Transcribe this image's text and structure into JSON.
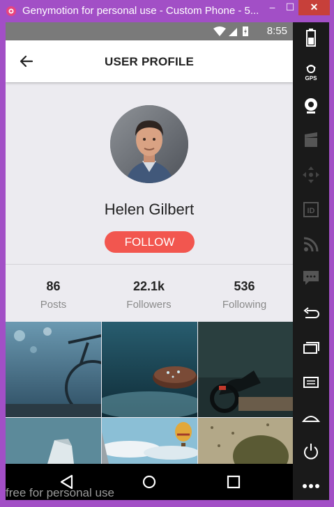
{
  "window": {
    "title": "Genymotion for personal use - Custom Phone - 5....",
    "minimize_glyph": "–",
    "maximize_glyph": "☐",
    "close_glyph": "✕"
  },
  "statusbar": {
    "time": "8:55"
  },
  "appbar": {
    "title": "USER PROFILE",
    "back_icon": "arrow-left-icon"
  },
  "profile": {
    "name": "Helen Gilbert",
    "follow_label": "FOLLOW",
    "accent": "#f2564f"
  },
  "stats": [
    {
      "value": "86",
      "label": "Posts"
    },
    {
      "value": "22.1k",
      "label": "Followers"
    },
    {
      "value": "536",
      "label": "Following"
    }
  ],
  "gallery": [
    "bicycle-photo",
    "coffee-beans-photo",
    "motorcycle-photo",
    "box-photo",
    "hot-air-balloon-photo",
    "rainy-window-photo"
  ],
  "nav": {
    "back_icon": "triangle-back-icon",
    "home_icon": "circle-home-icon",
    "recent_icon": "square-recent-icon"
  },
  "sidebar_icons": [
    "battery-icon",
    "gps-icon",
    "camera-icon",
    "clapper-icon",
    "dpad-icon",
    "id-icon",
    "rss-icon",
    "message-icon",
    "back-arrow-icon",
    "recent-apps-icon",
    "menu-icon",
    "home-icon",
    "power-icon",
    "more-icon"
  ],
  "sidebar_labels": {
    "gps": "GPS",
    "id": "ID"
  },
  "watermark": "free for personal use"
}
